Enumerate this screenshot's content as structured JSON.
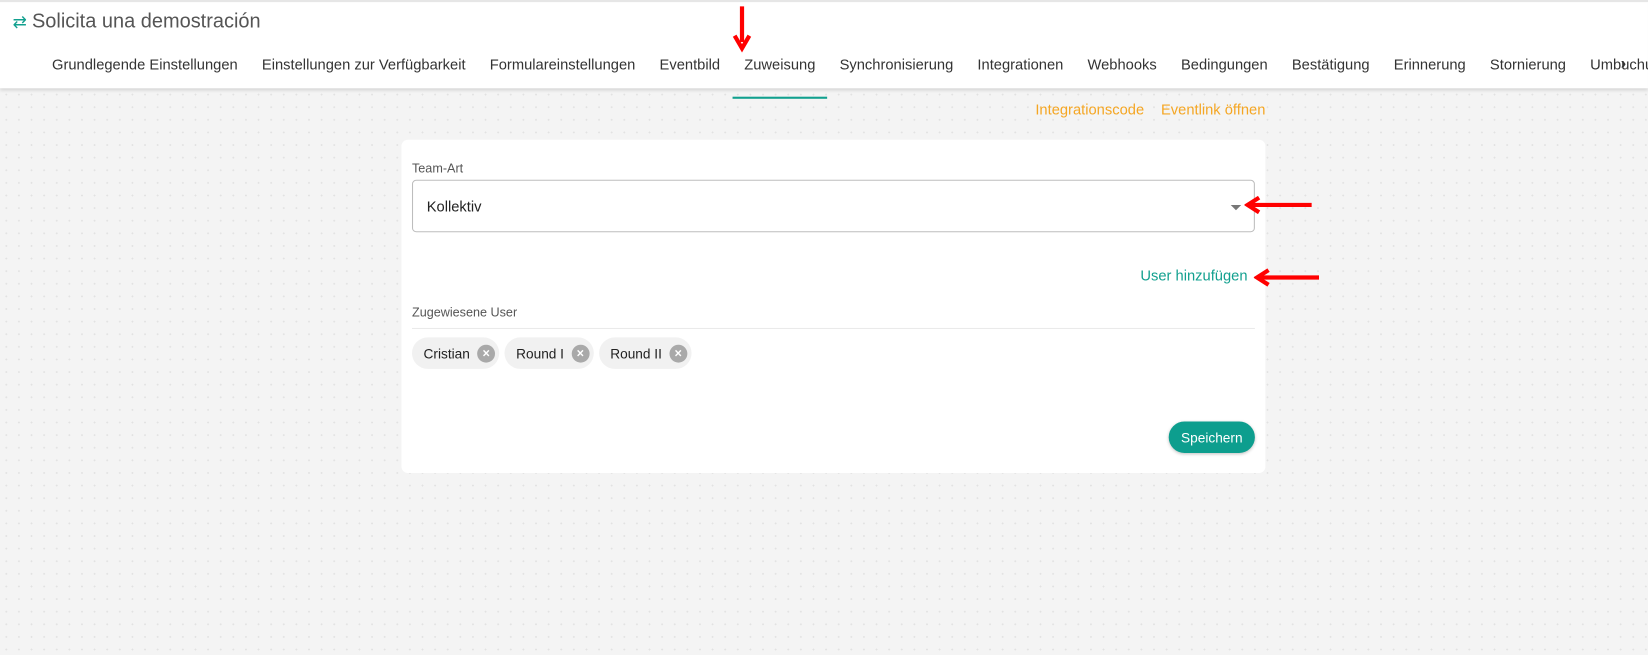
{
  "header": {
    "title": "Solicita una demostración",
    "title_icon": "swap-arrows-icon",
    "tabs": [
      {
        "label": "Grundlegende Einstellungen"
      },
      {
        "label": "Einstellungen zur Verfügbarkeit"
      },
      {
        "label": "Formulareinstellungen"
      },
      {
        "label": "Eventbild"
      },
      {
        "label": "Zuweisung",
        "active": true
      },
      {
        "label": "Synchronisierung"
      },
      {
        "label": "Integrationen"
      },
      {
        "label": "Webhooks"
      },
      {
        "label": "Bedingungen"
      },
      {
        "label": "Bestätigung"
      },
      {
        "label": "Erinnerung"
      },
      {
        "label": "Stornierung"
      },
      {
        "label": "Umbuchung"
      }
    ],
    "next_icon": "chevron-right-icon"
  },
  "links": {
    "integration_code": "Integrationscode",
    "open_event_link": "Eventlink öffnen"
  },
  "form": {
    "team_type_label": "Team-Art",
    "team_type_value": "Kollektiv",
    "add_user": "User hinzufügen",
    "assigned_label": "Zugewiesene User",
    "assigned_users": [
      "Cristian",
      "Round I",
      "Round II"
    ],
    "save": "Speichern"
  },
  "colors": {
    "accent": "#12a08f",
    "link_orange": "#f5a623",
    "annotation_red": "#ff0000"
  }
}
